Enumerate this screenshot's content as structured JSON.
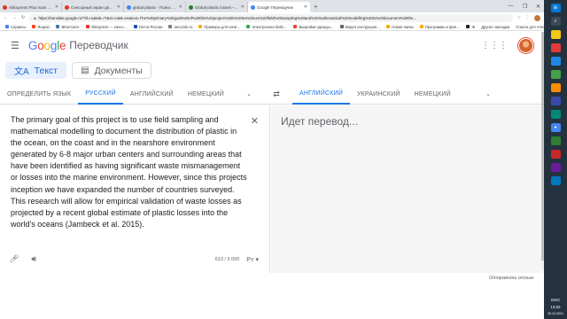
{
  "browser": {
    "tabs": [
      {
        "title": "AliExpress Plus main page",
        "color": "#e43225",
        "active": false
      },
      {
        "title": "Сенсорный экран два USB-по…",
        "color": "#e43225",
        "active": false
      },
      {
        "title": "global plastic - Поиск в Google",
        "color": "#4285f4",
        "active": false
      },
      {
        "title": "Global plastic losses – Marine D…",
        "color": "#2e7d32",
        "active": false
      },
      {
        "title": "Google Переводчик",
        "color": "#4285f4",
        "active": true
      }
    ],
    "new_tab": "+",
    "url": "https://translate.google.ru/?hl=ru&tab=rT&sl=ru&tl=en&text=The%20primary%20goal%20of%20this%20project%20is%20to%20use%20field%20sampling%20and%20mathematical%20modelling%20to%20document%20the…",
    "bookmarks": [
      {
        "label": "Сервисы",
        "color": "#4285f4"
      },
      {
        "label": "Яндекс",
        "color": "#fc3f1d"
      },
      {
        "label": "ВКонтакте",
        "color": "#4a76a8"
      },
      {
        "label": "AliExpress — качес…",
        "color": "#e43225"
      },
      {
        "label": "Почта России",
        "color": "#1d4ea8"
      },
      {
        "label": "aeroclub.ru",
        "color": "#7b7b7b"
      },
      {
        "label": "Примеры для начи…",
        "color": "#f9ab00"
      },
      {
        "label": "Электронная библ…",
        "color": "#34a853"
      },
      {
        "label": "Выкройки одежды…",
        "color": "#ea4335"
      },
      {
        "label": "Видео инструкция…",
        "color": "#5f6368"
      },
      {
        "label": "Новая папка",
        "color": "#f9ab00"
      },
      {
        "label": "Программы и фил…",
        "color": "#f9ab00"
      },
      {
        "label": "Ж",
        "color": "#202124"
      }
    ],
    "bookmarks_right": [
      "Другие закладки",
      "Список для чтения"
    ]
  },
  "header": {
    "logo_letters": [
      "G",
      "o",
      "o",
      "g",
      "l",
      "e"
    ],
    "product": "Переводчик"
  },
  "modes": [
    {
      "label": "Текст",
      "icon": "text-icon",
      "active": true
    },
    {
      "label": "Документы",
      "icon": "document-icon",
      "active": false
    }
  ],
  "source_langs": [
    "ОПРЕДЕЛИТЬ ЯЗЫК",
    "РУССКИЙ",
    "АНГЛИЙСКИЙ",
    "НЕМЕЦКИЙ"
  ],
  "target_langs": [
    "АНГЛИЙСКИЙ",
    "УКРАИНСКИЙ",
    "НЕМЕЦКИЙ"
  ],
  "source": {
    "text": "The primary goal of this project is to use field sampling and mathematical modelling to document the distribution of plastic in the ocean, on the coast and in the nearshore environment generated by 6-8 major urban centers and surrounding areas that have been identified as having significant waste mismanagement or losses into the marine environment.  However, since this projects inception we have expanded the number of countries surveyed. This research will allow for empirical validation of waste losses as projected by a recent global estimate of plastic losses into the world's oceans (Jambeck et al. 2015).",
    "count": "613 / 5 000"
  },
  "target": {
    "text": "Идет перевод..."
  },
  "feedback": "Отправить отзыв",
  "taskbar": {
    "time": "13:02",
    "date": "25.12.2021",
    "lang": "ENG"
  }
}
